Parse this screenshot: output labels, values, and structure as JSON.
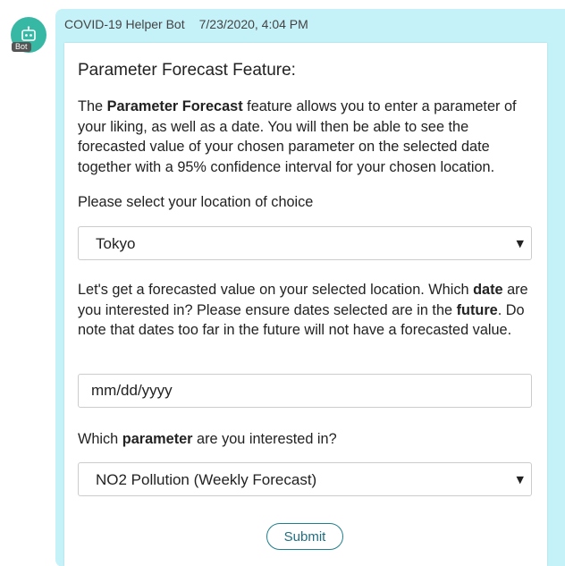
{
  "message": {
    "sender": "COVID-19 Helper Bot",
    "timestamp": "7/23/2020, 4:04 PM",
    "avatar_badge": "Bot",
    "avatar_icon": "robot-icon",
    "bubble_color": "#c5f1f8",
    "avatar_color": "#36b8a4"
  },
  "card": {
    "title": "Parameter Forecast Feature:",
    "intro": {
      "prefix": "The ",
      "bold": "Parameter Forecast",
      "suffix": " feature allows you to enter a parameter of your liking, as well as a date. You will then be able to see the forecasted value of your chosen parameter on the selected date together with a 95% confidence interval for your chosen location."
    },
    "location_prompt": "Please select your location of choice",
    "location_select": {
      "value": "Tokyo"
    },
    "date_prompt": {
      "part1": "Let's get a forecasted value on your selected location. Which ",
      "bold1": "date",
      "part2": " are you interested in? Please ensure dates selected are in the ",
      "bold2": "future",
      "part3": ". Do note that dates too far in the future will not have a forecasted value."
    },
    "date_input": {
      "placeholder": "mm/dd/yyyy"
    },
    "parameter_prompt": {
      "part1": "Which ",
      "bold": "parameter",
      "part2": " are you interested in?"
    },
    "parameter_select": {
      "value": "NO2 Pollution (Weekly Forecast)"
    },
    "submit_label": "Submit"
  }
}
